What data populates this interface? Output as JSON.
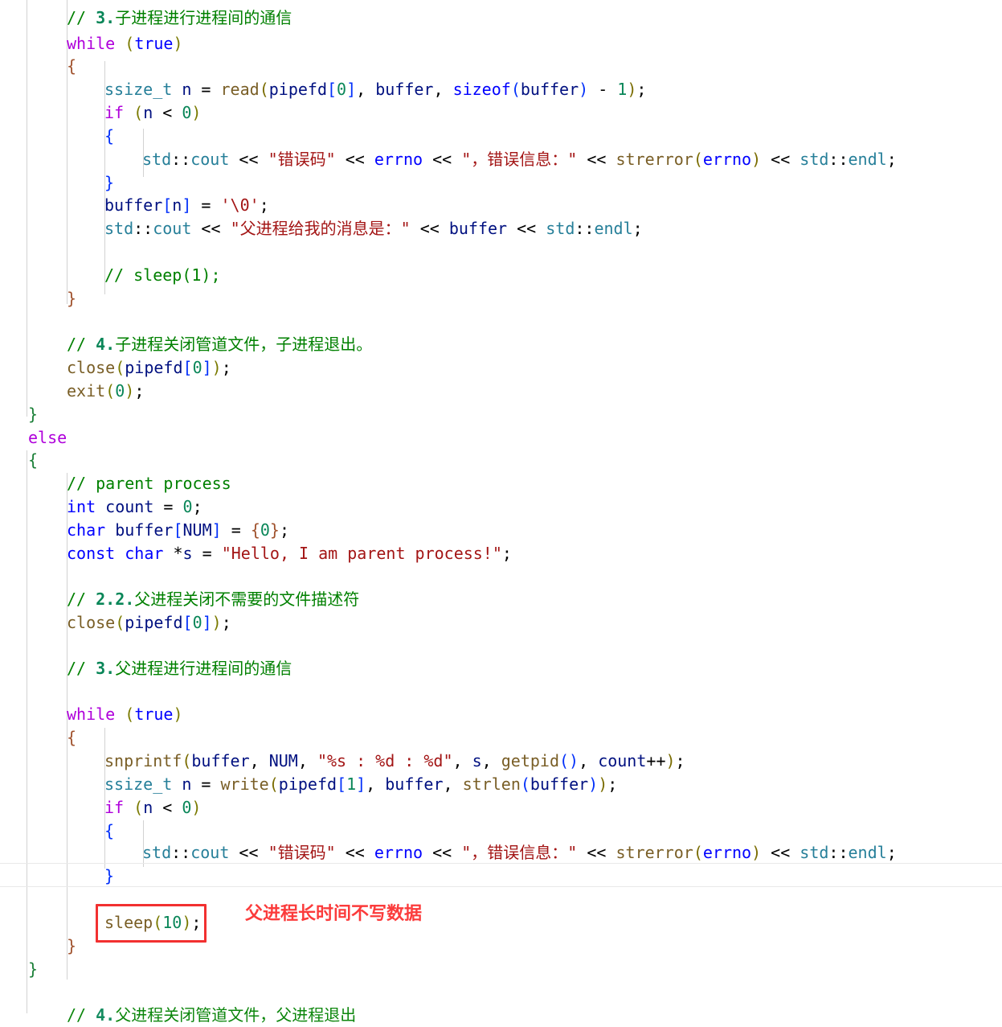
{
  "editor": {
    "language": "C++",
    "theme": "light-plus",
    "font_size_px": 20,
    "line_height_px": 28.6,
    "background_color": "#ffffff",
    "indent_guide_color": "#d2d2d2",
    "seam_color": "#e8e8e8"
  },
  "annotation": {
    "note_text": "父进程长时间不写数据",
    "note_color": "#fb3b3b",
    "box_border_color": "#f23030",
    "boxed_code": "sleep(10);"
  },
  "colors": {
    "keyword_control": "#af00db",
    "keyword_type": "#0000ff",
    "type_namespace": "#267f99",
    "function": "#795e26",
    "variable": "#001080",
    "number": "#098658",
    "string": "#a31515",
    "comment": "#008000",
    "brace_level0": "#1a7f37",
    "brace_level1": "#a0522d",
    "brace_level2": "#0431fa",
    "paren_olive": "#7a7a00"
  },
  "code": {
    "lines": [
      {
        "n": 1,
        "indent": 2,
        "text": "// 3.子进程进行进程间的通信"
      },
      {
        "n": 2,
        "indent": 2,
        "text": "while (true)"
      },
      {
        "n": 3,
        "indent": 2,
        "text": "{"
      },
      {
        "n": 4,
        "indent": 3,
        "text": "ssize_t n = read(pipefd[0], buffer, sizeof(buffer) - 1);"
      },
      {
        "n": 5,
        "indent": 3,
        "text": "if (n < 0)"
      },
      {
        "n": 6,
        "indent": 3,
        "text": "{"
      },
      {
        "n": 7,
        "indent": 4,
        "text": "std::cout << \"错误码\" << errno << \"，错误信息：\" << strerror(errno) << std::endl;"
      },
      {
        "n": 8,
        "indent": 3,
        "text": "}"
      },
      {
        "n": 9,
        "indent": 3,
        "text": "buffer[n] = '\\0';"
      },
      {
        "n": 10,
        "indent": 3,
        "text": "std::cout << \"父进程给我的消息是：\" << buffer << std::endl;"
      },
      {
        "n": 11,
        "indent": 0,
        "text": ""
      },
      {
        "n": 12,
        "indent": 3,
        "text": "// sleep(1);"
      },
      {
        "n": 13,
        "indent": 2,
        "text": "}"
      },
      {
        "n": 14,
        "indent": 0,
        "text": ""
      },
      {
        "n": 15,
        "indent": 2,
        "text": "// 4.子进程关闭管道文件，子进程退出。"
      },
      {
        "n": 16,
        "indent": 2,
        "text": "close(pipefd[0]);"
      },
      {
        "n": 17,
        "indent": 2,
        "text": "exit(0);"
      },
      {
        "n": 18,
        "indent": 1,
        "text": "}"
      },
      {
        "n": 19,
        "indent": 1,
        "text": "else"
      },
      {
        "n": 20,
        "indent": 1,
        "text": "{"
      },
      {
        "n": 21,
        "indent": 2,
        "text": "// parent process"
      },
      {
        "n": 22,
        "indent": 2,
        "text": "int count = 0;"
      },
      {
        "n": 23,
        "indent": 2,
        "text": "char buffer[NUM] = {0};"
      },
      {
        "n": 24,
        "indent": 2,
        "text": "const char *s = \"Hello, I am parent process!\";"
      },
      {
        "n": 25,
        "indent": 0,
        "text": ""
      },
      {
        "n": 26,
        "indent": 2,
        "text": "// 2.2.父进程关闭不需要的文件描述符"
      },
      {
        "n": 27,
        "indent": 2,
        "text": "close(pipefd[0]);"
      },
      {
        "n": 28,
        "indent": 0,
        "text": ""
      },
      {
        "n": 29,
        "indent": 2,
        "text": "// 3.父进程进行进程间的通信"
      },
      {
        "n": 30,
        "indent": 0,
        "text": ""
      },
      {
        "n": 31,
        "indent": 2,
        "text": "while (true)"
      },
      {
        "n": 32,
        "indent": 2,
        "text": "{"
      },
      {
        "n": 33,
        "indent": 3,
        "text": "snprintf(buffer, NUM, \"%s : %d : %d\", s, getpid(), count++);"
      },
      {
        "n": 34,
        "indent": 3,
        "text": "ssize_t n = write(pipefd[1], buffer, strlen(buffer));"
      },
      {
        "n": 35,
        "indent": 3,
        "text": "if (n < 0)"
      },
      {
        "n": 36,
        "indent": 3,
        "text": "{"
      },
      {
        "n": 37,
        "indent": 4,
        "text": "std::cout << \"错误码\" << errno << \"，错误信息：\" << strerror(errno) << std::endl;"
      },
      {
        "n": 38,
        "indent": 3,
        "text": "}"
      },
      {
        "n": 39,
        "indent": 0,
        "text": ""
      },
      {
        "n": 40,
        "indent": 3,
        "text": "sleep(10);"
      },
      {
        "n": 41,
        "indent": 2,
        "text": "}"
      },
      {
        "n": 42,
        "indent": 1,
        "text": "}"
      },
      {
        "n": 43,
        "indent": 0,
        "text": ""
      },
      {
        "n": 44,
        "indent": 2,
        "text": "// 4.父进程关闭管道文件，父进程退出"
      }
    ]
  }
}
